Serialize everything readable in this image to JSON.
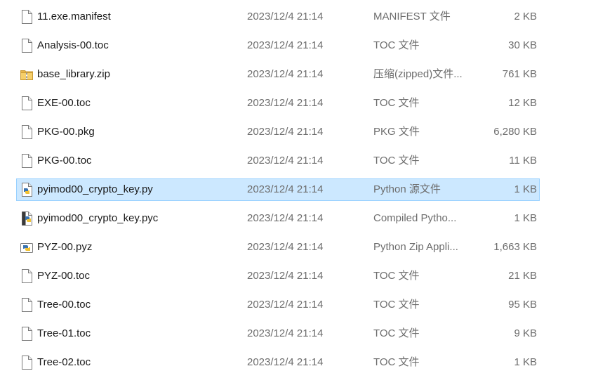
{
  "files": [
    {
      "name": "11.exe.manifest",
      "date": "2023/12/4 21:14",
      "type": "MANIFEST 文件",
      "size": "2 KB",
      "icon": "file-icon",
      "selected": false
    },
    {
      "name": "Analysis-00.toc",
      "date": "2023/12/4 21:14",
      "type": "TOC 文件",
      "size": "30 KB",
      "icon": "file-icon",
      "selected": false
    },
    {
      "name": "base_library.zip",
      "date": "2023/12/4 21:14",
      "type": "压缩(zipped)文件...",
      "size": "761 KB",
      "icon": "zip-folder-icon",
      "selected": false
    },
    {
      "name": "EXE-00.toc",
      "date": "2023/12/4 21:14",
      "type": "TOC 文件",
      "size": "12 KB",
      "icon": "file-icon",
      "selected": false
    },
    {
      "name": "PKG-00.pkg",
      "date": "2023/12/4 21:14",
      "type": "PKG 文件",
      "size": "6,280 KB",
      "icon": "file-icon",
      "selected": false
    },
    {
      "name": "PKG-00.toc",
      "date": "2023/12/4 21:14",
      "type": "TOC 文件",
      "size": "11 KB",
      "icon": "file-icon",
      "selected": false
    },
    {
      "name": "pyimod00_crypto_key.py",
      "date": "2023/12/4 21:14",
      "type": "Python 源文件",
      "size": "1 KB",
      "icon": "python-source-icon",
      "selected": true
    },
    {
      "name": "pyimod00_crypto_key.pyc",
      "date": "2023/12/4 21:14",
      "type": "Compiled Pytho...",
      "size": "1 KB",
      "icon": "python-compiled-icon",
      "selected": false
    },
    {
      "name": "PYZ-00.pyz",
      "date": "2023/12/4 21:14",
      "type": "Python Zip Appli...",
      "size": "1,663 KB",
      "icon": "python-zip-icon",
      "selected": false
    },
    {
      "name": "PYZ-00.toc",
      "date": "2023/12/4 21:14",
      "type": "TOC 文件",
      "size": "21 KB",
      "icon": "file-icon",
      "selected": false
    },
    {
      "name": "Tree-00.toc",
      "date": "2023/12/4 21:14",
      "type": "TOC 文件",
      "size": "95 KB",
      "icon": "file-icon",
      "selected": false
    },
    {
      "name": "Tree-01.toc",
      "date": "2023/12/4 21:14",
      "type": "TOC 文件",
      "size": "9 KB",
      "icon": "file-icon",
      "selected": false
    },
    {
      "name": "Tree-02.toc",
      "date": "2023/12/4 21:14",
      "type": "TOC 文件",
      "size": "1 KB",
      "icon": "file-icon",
      "selected": false
    }
  ],
  "colors": {
    "selection_bg": "#cce8ff",
    "selection_border": "#99d1ff",
    "name_text": "#1a1a1a",
    "meta_text": "#6d6d6d"
  }
}
